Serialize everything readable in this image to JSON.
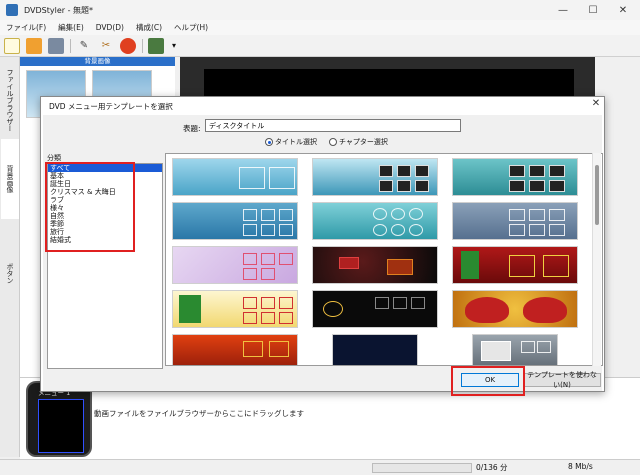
{
  "window": {
    "title": "DVDStyler - 無題*"
  },
  "menubar": [
    "ファイル(F)",
    "編集(E)",
    "DVD(D)",
    "構成(C)",
    "ヘルプ(H)"
  ],
  "vtabs": [
    "ファイルブラウザー",
    "背景画像",
    "ボタン"
  ],
  "bg_panel": {
    "header": "背景画像"
  },
  "bottom": {
    "menu_label": "メニュー 1",
    "drop_hint": "動画ファイルをファイルブラウザーからここにドラッグします"
  },
  "status": {
    "size": "0/136 分",
    "rate": "8 Mb/s",
    "progress": 0
  },
  "dialog": {
    "title": "DVD メニュー用テンプレートを選択",
    "title_label": "表題:",
    "title_value": "ディスクタイトル",
    "radio_title": "タイトル選択",
    "radio_chapter": "チャプター選択",
    "category_label": "分類",
    "categories": [
      "すべて",
      "基本",
      "誕生日",
      "クリスマス & 大晦日",
      "ラブ",
      "様々",
      "自然",
      "季節",
      "旅行",
      "結婚式"
    ],
    "selected_category": 0,
    "ok_label": "OK",
    "no_template_label": "テンプレートを使わない(N)"
  },
  "colors": {
    "accent": "#1a5bd6",
    "highlight": "#e02020",
    "progress": "#06b025"
  }
}
